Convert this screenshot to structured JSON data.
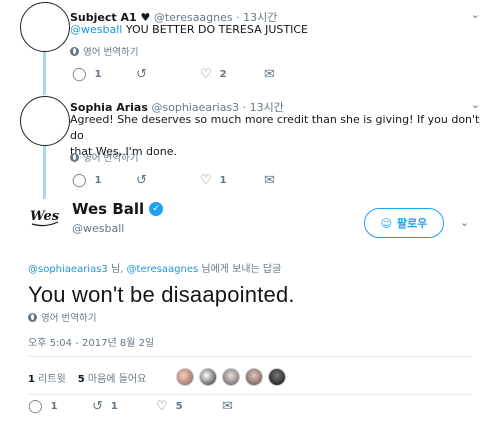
{
  "replies": [
    {
      "name": "Subject A1 ♥",
      "handle": "@teresaagnes",
      "time": "· 13시간",
      "mention": "@wesball",
      "text": " YOU BETTER DO TERESA JUSTICE",
      "translate": "영어 번역하기",
      "reply_count": "1",
      "retweet_count": "",
      "like_count": "2"
    },
    {
      "name": "Sophia Arias",
      "handle": "@sophiaearias3",
      "time": "· 13시간",
      "text_line1": "Agreed! She deserves so much more credit than she is giving! If you don't do",
      "text_line2": "that Wes, I'm done.",
      "translate": "영어 번역하기",
      "reply_count": "1",
      "retweet_count": "",
      "like_count": "1"
    }
  ],
  "main_tweet": {
    "name": "Wes Ball",
    "handle": "@wesball",
    "follow_label": "팔로우",
    "replying_mention1": "@sophiaearias3",
    "replying_sep": " 님, ",
    "replying_mention2": "@teresaagnes",
    "replying_suffix": " 님에게 보내는 답글",
    "text": "You won't be disaapointed.",
    "translate": "영어 번역하기",
    "timestamp": "오후 5:04 - 2017년 8월 2일",
    "retweets_count": "1",
    "retweets_label": " 리트윗",
    "likes_count": "5",
    "likes_label": " 마음에 들어요",
    "reply_count": "1",
    "retweet_count": "1",
    "like_count": "5"
  },
  "icons": {
    "reply": "speech-bubble-icon",
    "retweet": "retweet-icon",
    "like": "heart-icon",
    "dm": "envelope-icon",
    "chevron": "chevron-down-icon",
    "globe": "globe-icon",
    "verified": "verified-badge-icon"
  },
  "colors": {
    "accent": "#1da1f2",
    "link": "#1b95e0",
    "secondary_text": "#657786",
    "thread_line": "#a6d8f5"
  }
}
